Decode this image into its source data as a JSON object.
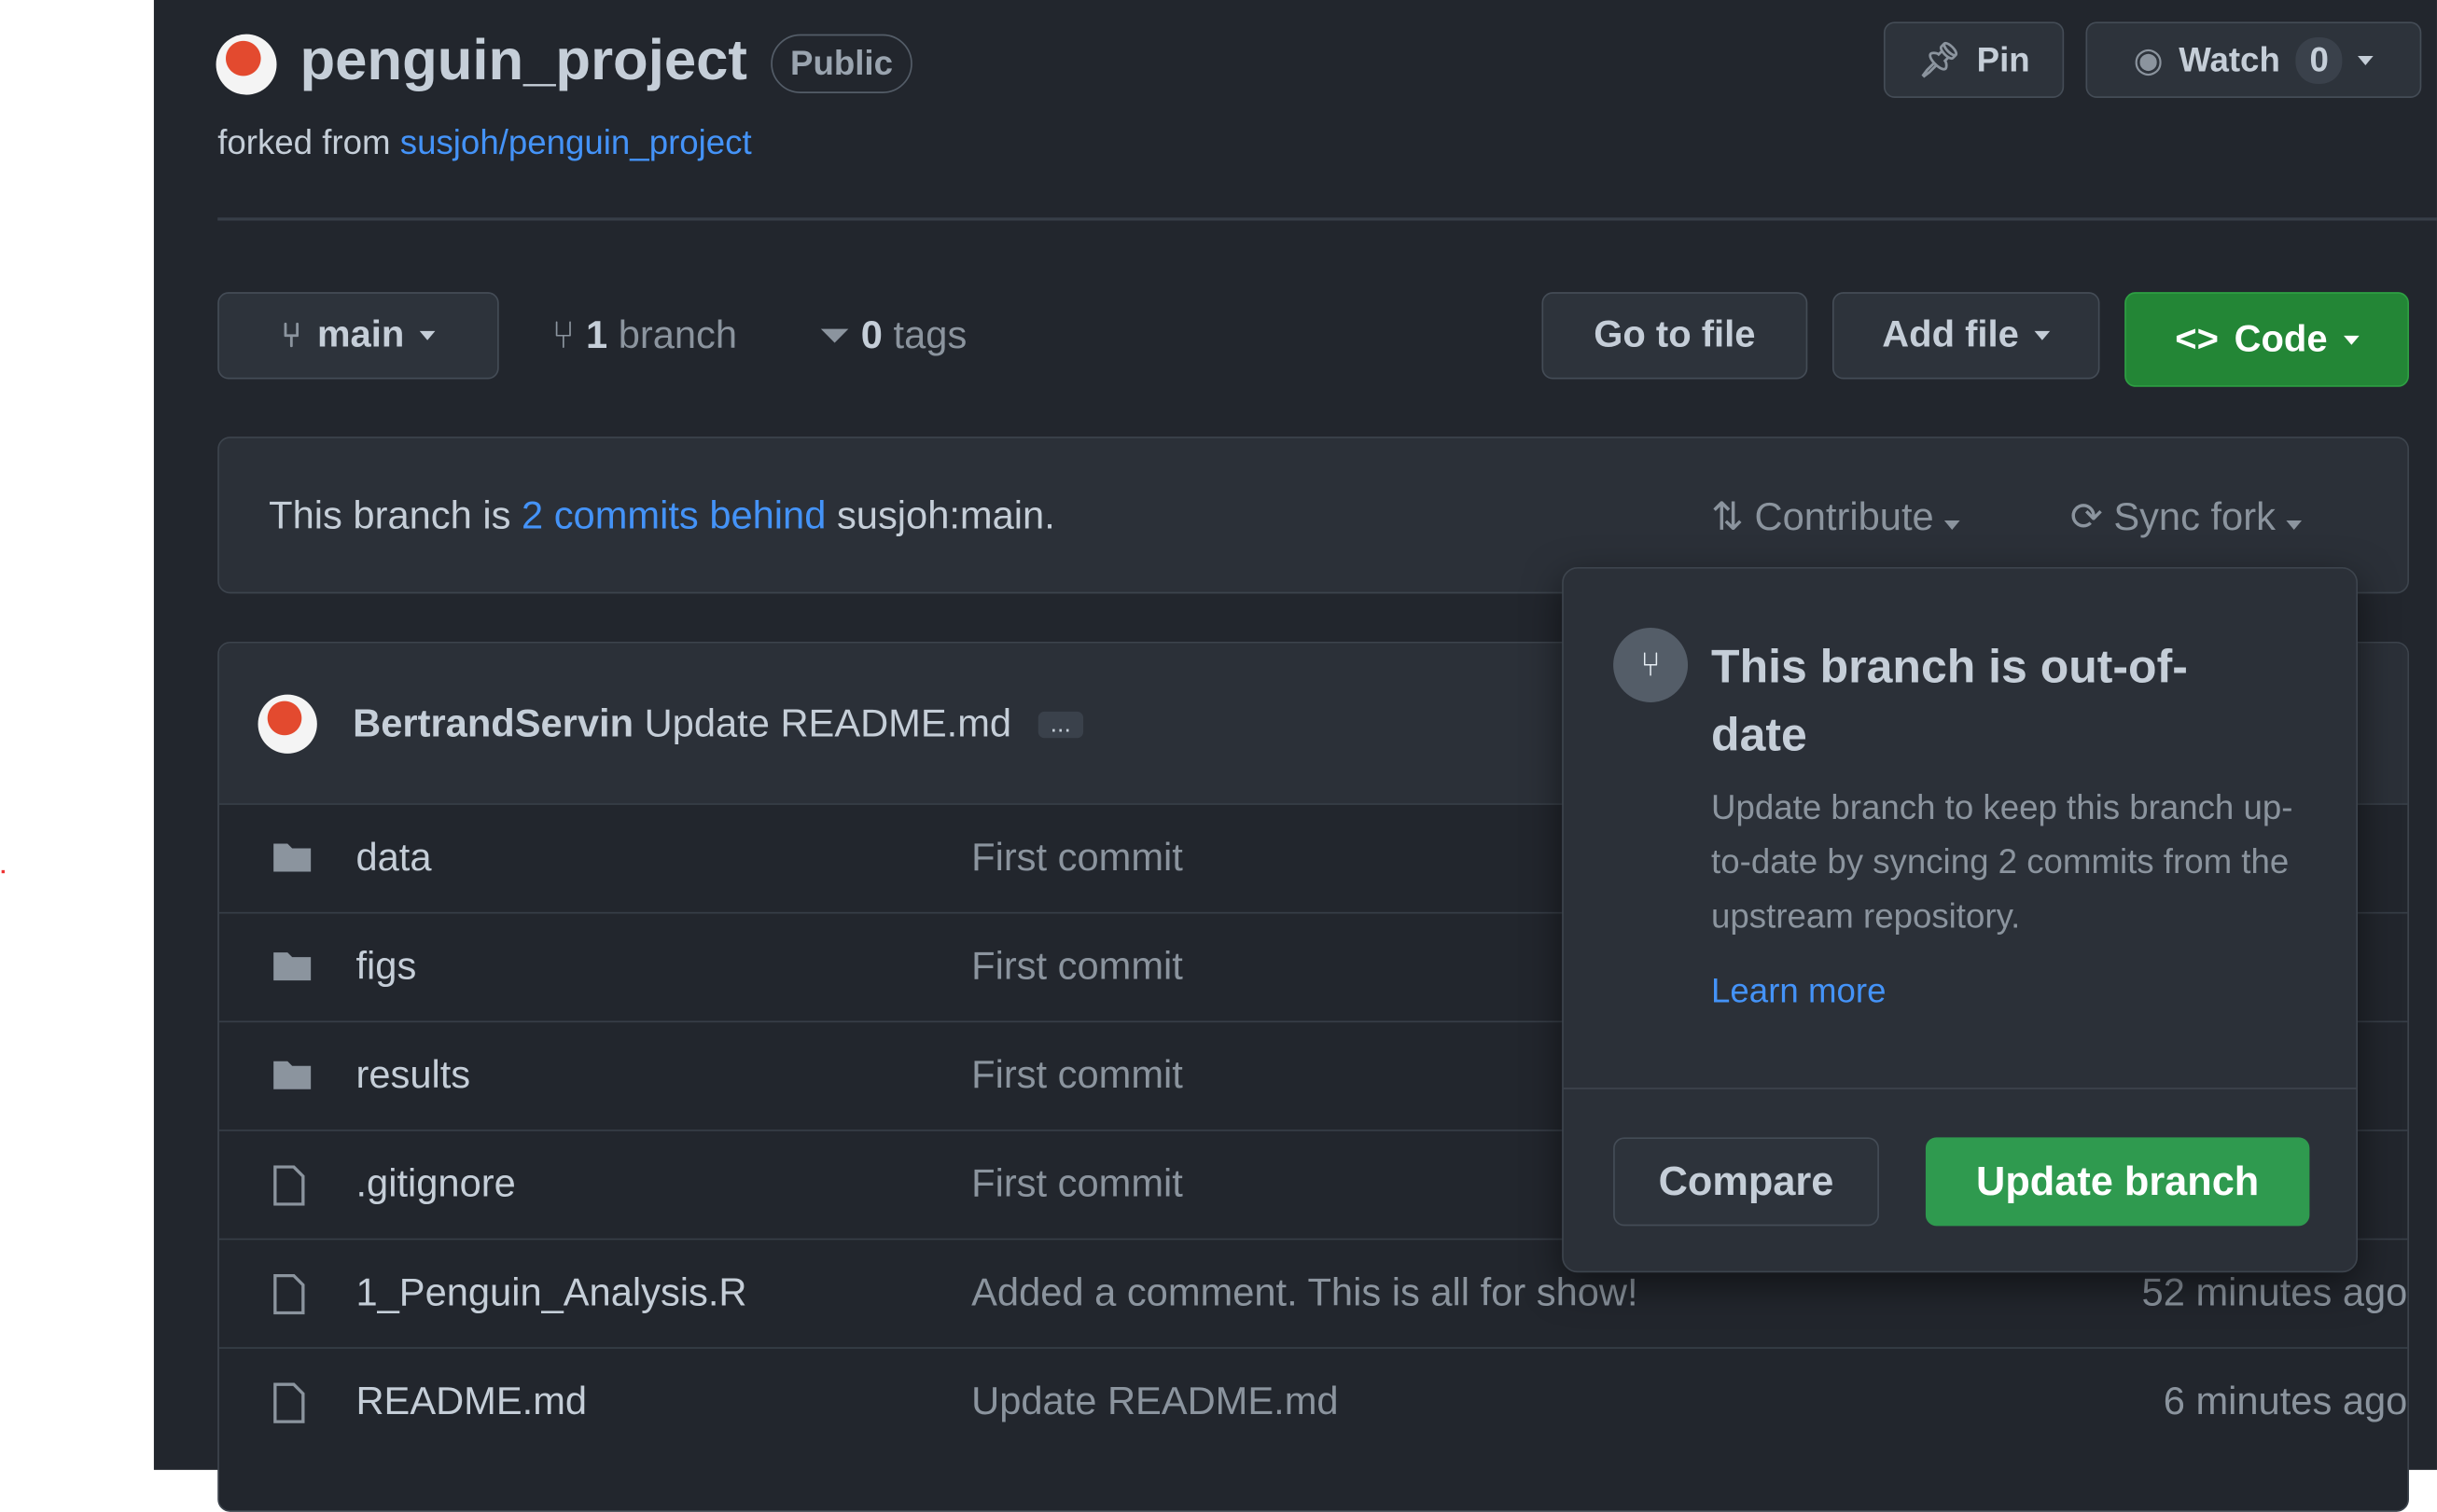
{
  "repo": {
    "name": "penguin_project",
    "visibility": "Public",
    "forked_prefix": "forked from",
    "forked_link": "susjoh/penguin_project"
  },
  "header_actions": {
    "pin": "Pin",
    "watch": "Watch",
    "watch_count": "0"
  },
  "toolbar": {
    "branch": "main",
    "branch_count": "1",
    "branch_label": "branch",
    "tag_count": "0",
    "tag_label": "tags",
    "go_to_file": "Go to file",
    "add_file": "Add file",
    "code": "Code"
  },
  "banner": {
    "prefix": "This branch is",
    "link": "2 commits behind",
    "suffix": "susjoh:main.",
    "contribute": "Contribute",
    "sync_fork": "Sync fork"
  },
  "latest_commit": {
    "author": "BertrandServin",
    "message": "Update README.md",
    "more": "..."
  },
  "files": [
    {
      "name": "data",
      "type": "folder",
      "message": "First commit",
      "time": ""
    },
    {
      "name": "figs",
      "type": "folder",
      "message": "First commit",
      "time": ""
    },
    {
      "name": "results",
      "type": "folder",
      "message": "First commit",
      "time": ""
    },
    {
      "name": ".gitignore",
      "type": "file",
      "message": "First commit",
      "time": ""
    },
    {
      "name": "1_Penguin_Analysis.R",
      "type": "file",
      "message": "Added a comment. This is all for show!",
      "time": "52 minutes ago"
    },
    {
      "name": "README.md",
      "type": "file",
      "message": "Update README.md",
      "time": "6 minutes ago"
    }
  ],
  "popover": {
    "title": "This branch is out-of-date",
    "description": "Update branch to keep this branch up-to-date by syncing 2 commits from the upstream repository.",
    "learn_more": "Learn more",
    "compare": "Compare",
    "update": "Update branch"
  },
  "colors": {
    "background": "#22262d",
    "green": "#238636",
    "link": "#4493f8"
  }
}
